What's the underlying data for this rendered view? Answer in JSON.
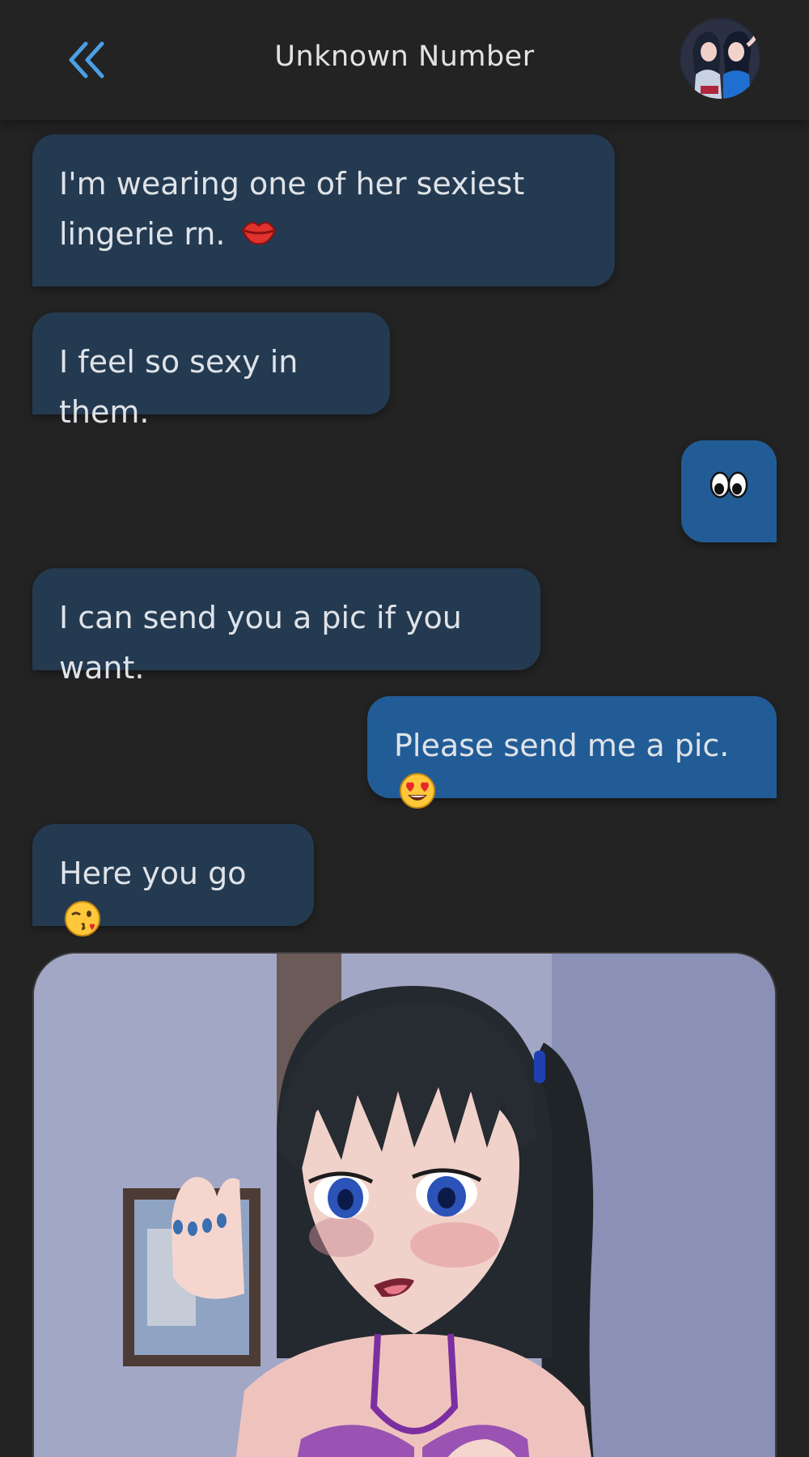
{
  "header": {
    "title": "Unknown Number",
    "back_icon": "double-chevron-left-icon",
    "avatar": "contact-avatar"
  },
  "messages": [
    {
      "direction": "incoming",
      "text": "I'm wearing one of her sexiest lingerie rn.",
      "emoji": "kiss-lips-emoji"
    },
    {
      "direction": "incoming",
      "text": "I feel so sexy in them."
    },
    {
      "direction": "outgoing",
      "text": "",
      "emoji": "eyes-emoji"
    },
    {
      "direction": "incoming",
      "text": "I can send you a pic if you want."
    },
    {
      "direction": "outgoing",
      "text": "Please send me a pic.",
      "emoji": "heart-eyes-emoji"
    },
    {
      "direction": "incoming",
      "text": "Here you go",
      "emoji": "kissing-wink-emoji"
    },
    {
      "direction": "incoming",
      "type": "image",
      "description_icon": "photo-attachment"
    }
  ],
  "colors": {
    "background": "#232323",
    "incoming_bubble": "#243a51",
    "outgoing_bubble": "#225c96",
    "accent_back": "#4a9fe6",
    "text": "#dfe3e8"
  }
}
